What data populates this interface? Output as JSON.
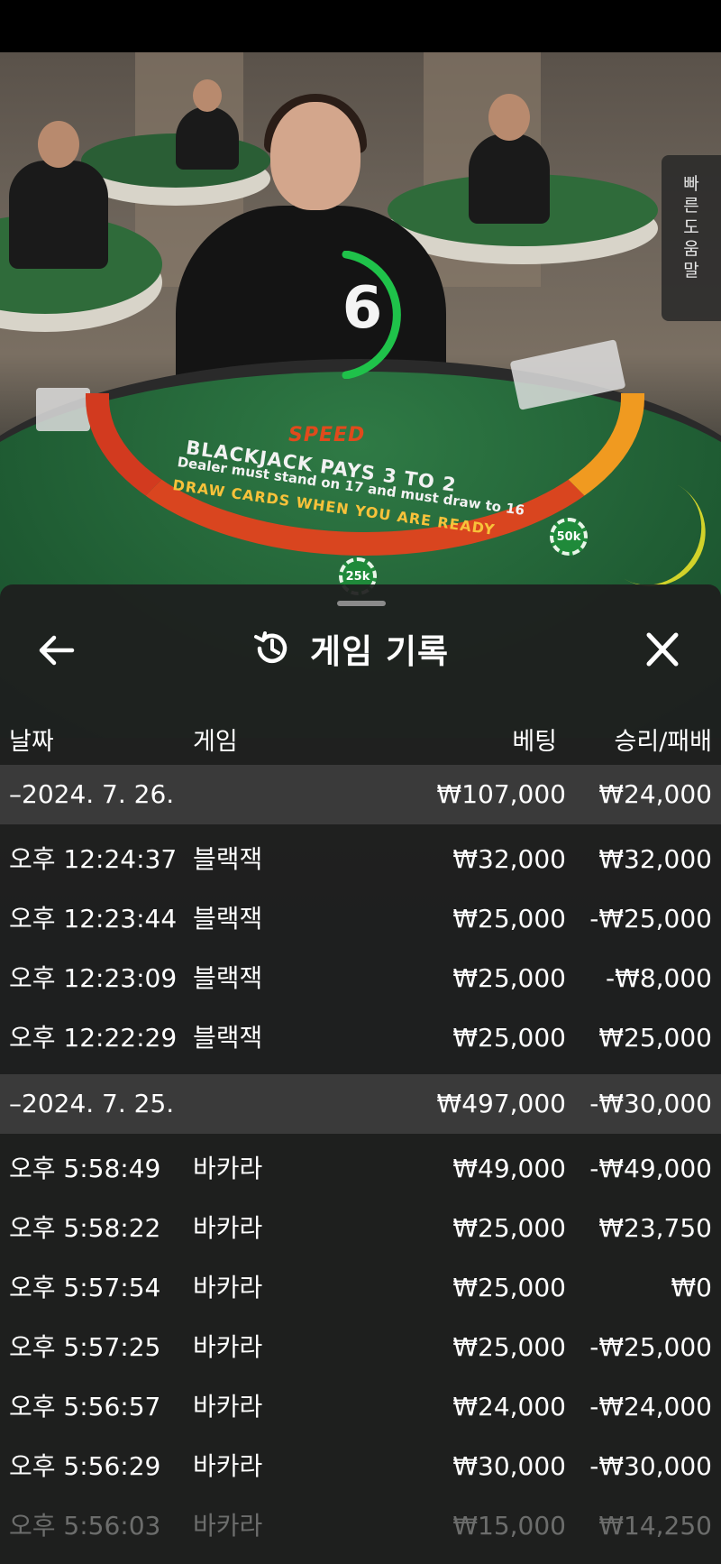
{
  "video": {
    "countdown": "6",
    "table_brand": "SPEED",
    "table_line1": "BLACKJACK PAYS 3 TO 2",
    "table_line2": "Dealer must stand on 17 and must draw to 16",
    "table_line3": "DRAW CARDS WHEN YOU ARE READY",
    "chips": [
      "25k",
      "50k"
    ],
    "help_tab_label": "빠른 도움말"
  },
  "sheet": {
    "title": "게임 기록",
    "back_icon": "arrow-left-icon",
    "history_icon": "history-icon",
    "close_icon": "close-icon",
    "columns": {
      "date": "날짜",
      "game": "게임",
      "bet": "베팅",
      "win_loss": "승리/패배"
    },
    "groups": [
      {
        "date": "–2024. 7. 26.",
        "bet_total": "₩107,000",
        "win_total": "₩24,000",
        "rows": [
          {
            "time": "오후 12:24:37",
            "game": "블랙잭",
            "bet": "₩32,000",
            "win": "₩32,000"
          },
          {
            "time": "오후 12:23:44",
            "game": "블랙잭",
            "bet": "₩25,000",
            "win": "-₩25,000"
          },
          {
            "time": "오후 12:23:09",
            "game": "블랙잭",
            "bet": "₩25,000",
            "win": "-₩8,000"
          },
          {
            "time": "오후 12:22:29",
            "game": "블랙잭",
            "bet": "₩25,000",
            "win": "₩25,000"
          }
        ]
      },
      {
        "date": "–2024. 7. 25.",
        "bet_total": "₩497,000",
        "win_total": "-₩30,000",
        "rows": [
          {
            "time": "오후 5:58:49",
            "game": "바카라",
            "bet": "₩49,000",
            "win": "-₩49,000"
          },
          {
            "time": "오후 5:58:22",
            "game": "바카라",
            "bet": "₩25,000",
            "win": "₩23,750"
          },
          {
            "time": "오후 5:57:54",
            "game": "바카라",
            "bet": "₩25,000",
            "win": "₩0"
          },
          {
            "time": "오후 5:57:25",
            "game": "바카라",
            "bet": "₩25,000",
            "win": "-₩25,000"
          },
          {
            "time": "오후 5:56:57",
            "game": "바카라",
            "bet": "₩24,000",
            "win": "-₩24,000"
          },
          {
            "time": "오후 5:56:29",
            "game": "바카라",
            "bet": "₩30,000",
            "win": "-₩30,000"
          }
        ]
      }
    ],
    "partial_row": {
      "time": "오후 5:56:03",
      "game": "바카라",
      "bet": "₩15,000",
      "win": "₩14,250"
    }
  }
}
